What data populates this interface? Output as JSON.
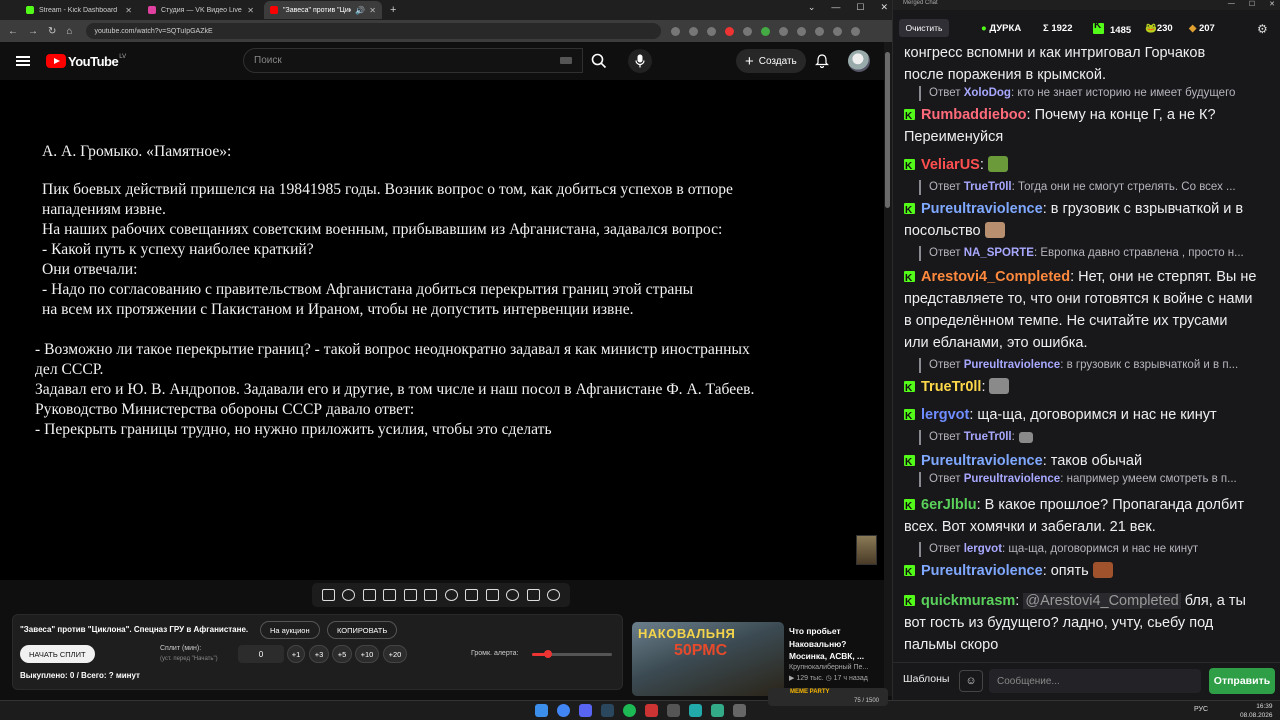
{
  "browser": {
    "tabs": [
      {
        "title": "Stream - Kick Dashboard",
        "color": "#53fc18"
      },
      {
        "title": "Студия — VK Видео Live",
        "color": "#e040a0"
      },
      {
        "title": "\"Завеса\" против \"Циклона\"",
        "color": "#ff0000"
      }
    ],
    "url": "youtube.com/watch?v=SQTuIpGAZkE"
  },
  "youtube": {
    "logo_text": "YouTube",
    "country": "LV",
    "search_placeholder": "Поиск",
    "create_label": "Создать"
  },
  "video": {
    "lines": [
      "А. А. Громыко. «Памятное»:",
      "Пик боевых действий пришелся на 19841985 годы. Возник вопрос о том, как добиться успехов в отпоре",
      "нападениям извне.",
      "На наших рабочих совещаниях советским военным, прибывавшим из Афганистана, задавался вопрос:",
      "- Какой путь к успеху наиболее краткий?",
      "Они отвечали:",
      "- Надо по согласованию с правительством Афганистана добиться перекрытия границ этой страны",
      "на всем их протяжении с Пакистаном и Ираном, чтобы не допустить интервенции извне.",
      "- Возможно ли такое перекрытие границ? -  такой вопрос неоднократно задавал я как министр иностранных",
      "дел СССР.",
      "Задавал его и  Ю. В. Андропов. Задавали его и другие, в том числе и наш посол в Афганистане Ф. А. Табеев.",
      "Руководство Министерства обороны СССР давало ответ:",
      "- Перекрыть границы трудно, но нужно приложить усилия, чтобы это сделать"
    ]
  },
  "panel": {
    "title": "\"Завеса\" против \"Циклона\". Спецназ ГРУ в Афганистане.",
    "auction_label": "На аукцион",
    "copy_label": "КОПИРОВАТЬ",
    "start_split_label": "НАЧАТЬ СПЛИТ",
    "split_label": "Сплит (мин):",
    "split_hint": "(уст. перед \"Начать\")",
    "split_value": "0",
    "steps": [
      "+1",
      "+3",
      "+5",
      "+10",
      "+20"
    ],
    "alert_label": "Громк. алерта:",
    "alert_volume_percent": 20,
    "bought_text": "Выкуплено: 0 / Всего: ? минут"
  },
  "recommendation": {
    "thumb_text1": "НАКОВАЛЬНЯ",
    "thumb_text2": "50РМС",
    "title": "Что пробьет Наковальню? Мосинка, АСВК, ...",
    "channel": "Крупнокалиберный Пе...",
    "views": "129 тыс.",
    "age": "17 ч назад"
  },
  "chat": {
    "window_title": "Merged Chat",
    "clear_label": "Очистить",
    "stats": {
      "name": "ДУРКА",
      "sigma": "Σ 1922",
      "kick": "1485",
      "frog": "230",
      "vk": "207"
    },
    "messages": [
      {
        "type": "cont",
        "text": "конгресс вспомни и как интриговал Горчаков"
      },
      {
        "type": "cont",
        "text": "после поражения в крымской."
      },
      {
        "type": "reply",
        "prefix": "Ответ",
        "user": "XoloDog",
        "text": ": кто не знает историю не имеет будущего"
      },
      {
        "type": "msg",
        "user": "Rumbaddieboo",
        "color": "#ff6b7a",
        "text": ": Почему на конце Г, а не К?"
      },
      {
        "type": "cont",
        "text": "Переименуйся"
      },
      {
        "type": "msg",
        "user": "VeliarUS",
        "color": "#ff4f4f",
        "text": ":"
      },
      {
        "type": "reply",
        "prefix": "Ответ",
        "user": "TrueTr0ll",
        "text": ": Тогда они не смогут стрелять. Со всех ..."
      },
      {
        "type": "msg",
        "user": "Pureultraviolence",
        "color": "#7fa8ff",
        "text": ": в грузовик с взрывчаткой и в"
      },
      {
        "type": "cont",
        "text": "посольство"
      },
      {
        "type": "reply",
        "prefix": "Ответ",
        "user": "NA_SPORTE",
        "text": ": Европка давно стравлена , просто н..."
      },
      {
        "type": "msg",
        "user": "Arestovi4_Completed",
        "color": "#ff8a3d",
        "text": ": Нет, они не стерпят. Вы не"
      },
      {
        "type": "cont",
        "text": "представляете то, что они готовятся к войне с нами"
      },
      {
        "type": "cont",
        "text": "в определённом темпе. Не считайте их трусами"
      },
      {
        "type": "cont",
        "text": "или ебланами, это ошибка."
      },
      {
        "type": "reply",
        "prefix": "Ответ",
        "user": "Pureultraviolence",
        "text": ": в грузовик с взрывчаткой и в п..."
      },
      {
        "type": "msg",
        "user": "TrueTr0ll",
        "color": "#ffd84a",
        "text": ":"
      },
      {
        "type": "msg",
        "user": "lergvot",
        "color": "#6f8dff",
        "text": ": ща-ща, договоримся и нас не кинут"
      },
      {
        "type": "reply",
        "prefix": "Ответ",
        "user": "TrueTr0ll",
        "text": ":"
      },
      {
        "type": "msg",
        "user": "Pureultraviolence",
        "color": "#7fa8ff",
        "text": ": таков обычай"
      },
      {
        "type": "reply",
        "prefix": "Ответ",
        "user": "Pureultraviolence",
        "text": ": например умеем смотреть в п..."
      },
      {
        "type": "msg",
        "user": "6erJlblu",
        "color": "#5ad15a",
        "text": ": В какое прошлое? Пропаганда долбит"
      },
      {
        "type": "cont",
        "text": "всех. Вот хомячки и забегали. 21 век."
      },
      {
        "type": "reply",
        "prefix": "Ответ",
        "user": "lergvot",
        "text": ": ща-ща, договоримся и нас не кинут"
      },
      {
        "type": "msg",
        "user": "Pureultraviolence",
        "color": "#7fa8ff",
        "text": ": опять"
      },
      {
        "type": "msg",
        "user": "quickmurasm",
        "color": "#5ad15a",
        "mention": "@Arestovi4_Completed",
        "text": " бля, а ты"
      },
      {
        "type": "cont",
        "text": "вот гость из будущего? ладно, учту, сьебу под"
      },
      {
        "type": "cont",
        "text": "пальмы скоро"
      }
    ],
    "templates_label": "Шаблоны",
    "input_placeholder": "Сообщение...",
    "send_label": "Отправить"
  },
  "taskbar": {
    "lang": "РУС",
    "time": "16:39",
    "date": "08.08.2026",
    "meme_label": "MEME PARTY",
    "meme_counter": "75 / 1500"
  }
}
